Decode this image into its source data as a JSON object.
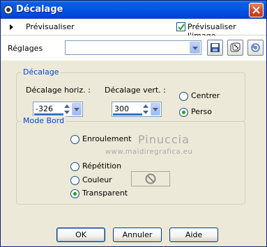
{
  "window": {
    "title": "Décalage"
  },
  "toolbar": {
    "preview_label": "Prévisualiser",
    "preview_checkbox_label": "Prévisualiser l'image",
    "preview_checked": true
  },
  "settings": {
    "label": "Réglages",
    "preset_value": ""
  },
  "offset_group": {
    "title": "Décalage",
    "horiz_label": "Décalage horiz. :",
    "horiz_value": "-326",
    "vert_label": "Décalage vert. :",
    "vert_value": "300",
    "options": [
      {
        "label": "Centrer",
        "selected": false
      },
      {
        "label": "Perso",
        "selected": true
      }
    ]
  },
  "edge_group": {
    "title": "Mode Bord",
    "options": [
      {
        "label": "Enroulement",
        "selected": false
      },
      {
        "label": "Répétition",
        "selected": false
      },
      {
        "label": "Couleur",
        "selected": false
      },
      {
        "label": "Transparent",
        "selected": true
      }
    ]
  },
  "watermark": {
    "line1": "Pinuccia",
    "line2": "www.maidiregrafica.eu"
  },
  "buttons": {
    "ok": "OK",
    "cancel": "Annuler",
    "help": "Aide"
  },
  "colors": {
    "title_bar": "#0055e5",
    "group_title": "#0046d5",
    "radio_selected": "#21a121"
  }
}
